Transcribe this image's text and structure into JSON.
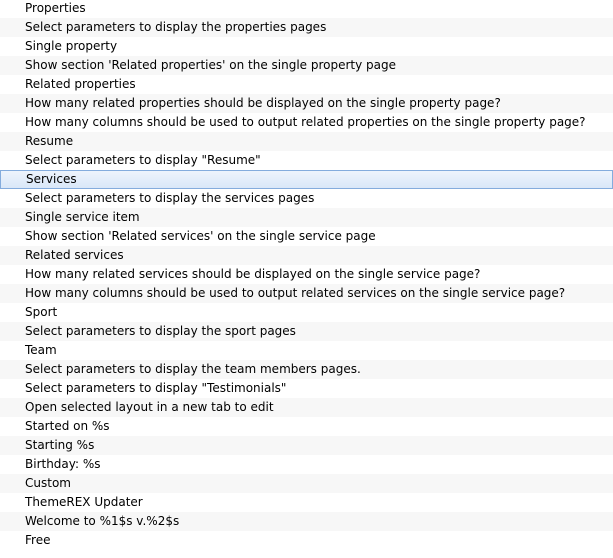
{
  "list": {
    "items": [
      {
        "label": "Properties"
      },
      {
        "label": "Select parameters to display the properties pages"
      },
      {
        "label": "Single property"
      },
      {
        "label": "Show section 'Related properties' on the single property page"
      },
      {
        "label": "Related properties"
      },
      {
        "label": "How many related properties should be displayed on the single property page?"
      },
      {
        "label": "How many columns should be used to output related properties on the single property page?"
      },
      {
        "label": "Resume"
      },
      {
        "label": "Select parameters to display \"Resume\""
      },
      {
        "label": "Services",
        "selected": true
      },
      {
        "label": "Select parameters to display the services pages"
      },
      {
        "label": "Single service item"
      },
      {
        "label": "Show section 'Related services' on the single service page"
      },
      {
        "label": "Related services"
      },
      {
        "label": "How many related services should be displayed on the single service page?"
      },
      {
        "label": "How many columns should be used to output related services on the single service page?"
      },
      {
        "label": "Sport"
      },
      {
        "label": "Select parameters to display the sport pages"
      },
      {
        "label": "Team"
      },
      {
        "label": "Select parameters to display the team members pages."
      },
      {
        "label": "Select parameters to display \"Testimonials\""
      },
      {
        "label": "Open selected layout in a new tab to edit"
      },
      {
        "label": "Started on %s"
      },
      {
        "label": "Starting %s"
      },
      {
        "label": "Birthday: %s"
      },
      {
        "label": "Custom"
      },
      {
        "label": "ThemeREX Updater"
      },
      {
        "label": "Welcome to %1$s v.%2$s"
      },
      {
        "label": "Free"
      }
    ]
  }
}
